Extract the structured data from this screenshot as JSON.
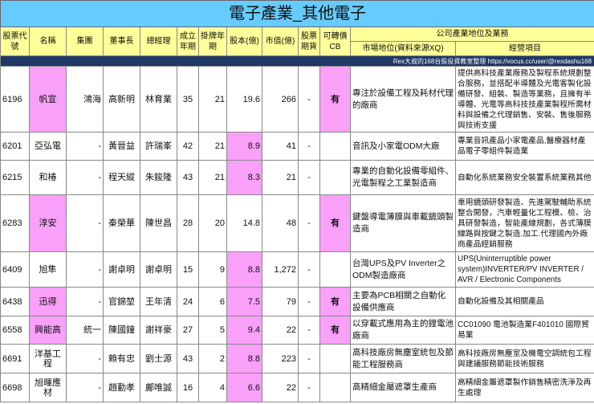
{
  "title": "電子產業_其他電子",
  "headers": {
    "code": "股票代號",
    "name": "名稱",
    "group": "集團",
    "chairman": "董事長",
    "gm": "總經理",
    "est": "成立年期",
    "listed": "掛牌年期",
    "capital": "股本(億)",
    "mcap": "市值(億)",
    "futures": "股票期貨",
    "cb": "可轉債CB",
    "section": "公司產業地位及業務",
    "position": "市場地位(資料來源XQ)",
    "business": "經營項目"
  },
  "credit": "Rex大叔的168台股投資教室整理 https://vocus.cc/user/@rexdashu168",
  "colors": {
    "title_bg": "#66ccff",
    "header_bg": "#ffff99",
    "highlight": "#f9a0f9",
    "bar": "#1f3864"
  },
  "rows": [
    {
      "code": "6196",
      "name": "帆宣",
      "group": "鴻海",
      "chairman": "高新明",
      "gm": "林育業",
      "est": "35",
      "listed": "21",
      "capital": "19.6",
      "mcap": "266",
      "futures": "-",
      "cb": "有",
      "position": "專注於設備工程及耗材代理的廠商",
      "business": "提供高科技產業廠務及製程系統規劃整合服務，並搭配半導體及光電客製化設備研發、組裝、製造等業務，且擁有半導體、光電等高科技技產業製程所需材料與設備之代理銷售、安裝、售後服務與技術支援"
    },
    {
      "code": "6201",
      "name": "亞弘電",
      "group": "-",
      "chairman": "黃晉益",
      "gm": "許瑞峯",
      "est": "42",
      "listed": "21",
      "capital": "8.9",
      "mcap": "41",
      "futures": "-",
      "cb": "",
      "position": "音訊及小家電ODM大廠",
      "business": "專業音訊產品小家電產品,醫療器材產品電子零組件製造業"
    },
    {
      "code": "6215",
      "name": "和椿",
      "group": "-",
      "chairman": "程天縱",
      "gm": "朱鋑隆",
      "est": "43",
      "listed": "21",
      "capital": "8.3",
      "mcap": "21",
      "futures": "-",
      "cb": "",
      "position": "專業的自動化設備零組件、光電製程之工業製造商",
      "business": "自動化系統業務安全裝置系統業務其他"
    },
    {
      "code": "6283",
      "name": "淳安",
      "group": "-",
      "chairman": "秦榮華",
      "gm": "陳世昌",
      "est": "28",
      "listed": "20",
      "capital": "14.8",
      "mcap": "48",
      "futures": "-",
      "cb": "有",
      "position": "鍵盤導電薄膜與車載鏡頭製造商",
      "business": "車用鏡頭研發製造、先進駕駛輔助系統整合開發，汽車輕量化工程模、檢、治具研發製造，智能產線規劃，各式薄膜線路與按鍵之製造.加工.代理國內外廠商產品經銷服務"
    },
    {
      "code": "6409",
      "name": "旭隼",
      "group": "-",
      "chairman": "謝卓明",
      "gm": "謝卓明",
      "est": "15",
      "listed": "9",
      "capital": "8.8",
      "mcap": "1,272",
      "futures": "-",
      "cb": "",
      "position": "台灣UPS及PV Inverter之ODM製造廠商",
      "business": "UPS(Uninterruptible power system)INVERTER/PV INVERTER / AVR / Electronic Components"
    },
    {
      "code": "6438",
      "name": "迅得",
      "group": "-",
      "chairman": "官錦堃",
      "gm": "王年清",
      "est": "24",
      "listed": "6",
      "capital": "7.5",
      "mcap": "79",
      "futures": "-",
      "cb": "有",
      "position": "主要為PCB相關之自動化設備供應商",
      "business": "自動化設備及其相關產品"
    },
    {
      "code": "6558",
      "name": "興能高",
      "group": "統一",
      "chairman": "陳國鐘",
      "gm": "謝祥豪",
      "est": "27",
      "listed": "5",
      "capital": "9.4",
      "mcap": "22",
      "futures": "-",
      "cb": "有",
      "position": "以穿載式應用為主的鋰電池廠商",
      "business": "CC01090 電池製造業F401010 國際貿易業"
    },
    {
      "code": "6691",
      "name": "洋基工程",
      "group": "-",
      "chairman": "賴有忠",
      "gm": "劉士源",
      "est": "43",
      "listed": "2",
      "capital": "8.8",
      "mcap": "223",
      "futures": "-",
      "cb": "",
      "position": "高科技廠房無塵室統包及節能工程服務商",
      "business": "高科技廠房無塵室及機電空調統包工程與建議服務節能技術服務"
    },
    {
      "code": "6698",
      "name": "旭暉應材",
      "group": "-",
      "chairman": "趙勤孝",
      "gm": "鄺唯誠",
      "est": "16",
      "listed": "4",
      "capital": "6.6",
      "mcap": "22",
      "futures": "-",
      "cb": "",
      "position": "高精細金屬遮罩生產商",
      "business": "高精細金屬遮罩製作銷售精密洗淨及再生處理"
    }
  ]
}
